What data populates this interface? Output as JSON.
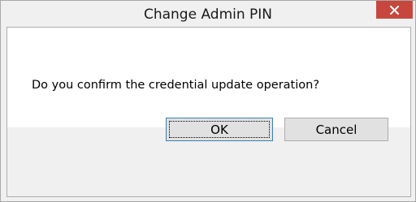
{
  "window": {
    "title": "Change Admin PIN",
    "close_icon": "close-icon"
  },
  "dialog": {
    "message": "Do you confirm the credential update operation?"
  },
  "buttons": {
    "ok_label": "OK",
    "cancel_label": "Cancel"
  },
  "colors": {
    "close_button": "#c7473e",
    "window_bg": "#f0f0f0",
    "content_bg": "#ffffff",
    "ok_border": "#3c7fb1"
  }
}
